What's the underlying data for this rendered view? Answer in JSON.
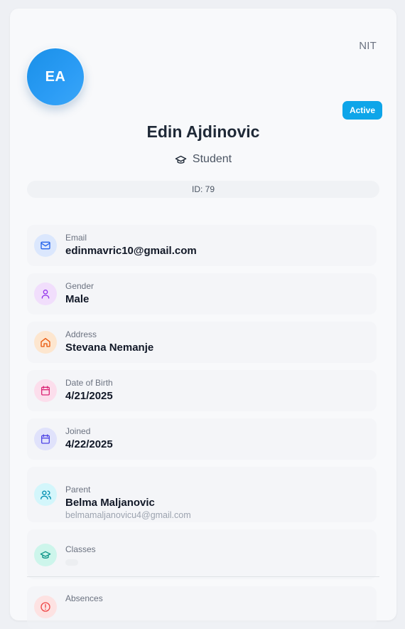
{
  "profile": {
    "school": "NIT",
    "initials": "EA",
    "status": "Active",
    "name": "Edin Ajdinovic",
    "role": "Student",
    "id_text": "ID: 79"
  },
  "fields": {
    "email": {
      "label": "Email",
      "value": "edinmavric10@gmail.com",
      "icon": "mail-icon"
    },
    "gender": {
      "label": "Gender",
      "value": "Male",
      "icon": "user-icon"
    },
    "address": {
      "label": "Address",
      "value": "Stevana Nemanje",
      "icon": "home-icon"
    },
    "dob": {
      "label": "Date of Birth",
      "value": "4/21/2025",
      "icon": "calendar-icon"
    },
    "joined": {
      "label": "Joined",
      "value": "4/22/2025",
      "icon": "calendar-icon"
    },
    "parent": {
      "label": "Parent",
      "value": "Belma Maljanovic",
      "sub": "belmamaljanovicu4@gmail.com",
      "icon": "users-icon"
    },
    "classes": {
      "label": "Classes",
      "icon": "graduation-cap-icon"
    },
    "absences": {
      "label": "Absences",
      "icon": "alert-icon"
    }
  },
  "colors": {
    "avatar": "#1a90e8",
    "status_badge": "#0ea5e9",
    "email_icon": "#2563eb",
    "gender_icon": "#9333ea",
    "address_icon": "#ea580c",
    "dob_icon": "#db2777",
    "joined_icon": "#4f46e5",
    "parent_icon": "#0891b2",
    "classes_icon": "#0d9488",
    "absences_icon": "#ef4444"
  }
}
